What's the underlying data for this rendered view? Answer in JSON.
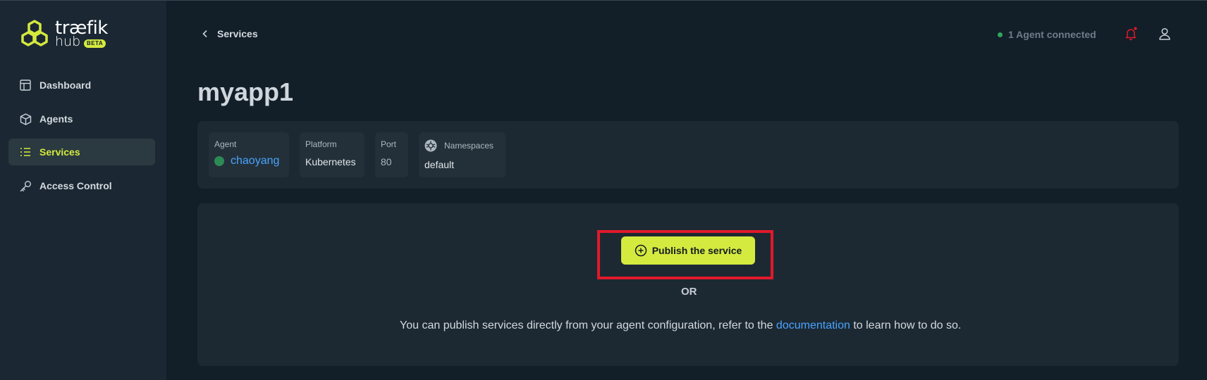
{
  "brand": {
    "name": "træfik",
    "sub": "hub",
    "badge": "BETA"
  },
  "sidebar": {
    "items": [
      {
        "label": "Dashboard",
        "icon": "dashboard-icon",
        "active": false
      },
      {
        "label": "Agents",
        "icon": "cube-icon",
        "active": false
      },
      {
        "label": "Services",
        "icon": "list-icon",
        "active": true
      },
      {
        "label": "Access Control",
        "icon": "key-icon",
        "active": false
      }
    ]
  },
  "header": {
    "back_label": "Services",
    "agent_status": "1 Agent connected",
    "notification_color": "#e0192a"
  },
  "page": {
    "title": "myapp1"
  },
  "info": {
    "agent": {
      "label": "Agent",
      "value": "chaoyang"
    },
    "platform": {
      "label": "Platform",
      "value": "Kubernetes"
    },
    "port": {
      "label": "Port",
      "value": "80"
    },
    "namespaces": {
      "label": "Namespaces",
      "value": "default"
    }
  },
  "publish": {
    "button_label": "Publish the service",
    "or_label": "OR",
    "help_before": "You can publish services directly from your agent configuration, refer to the ",
    "help_link": "documentation",
    "help_after": " to learn how to do so."
  },
  "colors": {
    "accent": "#d5ea3f",
    "link": "#4aa3ff",
    "highlight": "#e0192a",
    "status_connected": "#2fa55c"
  }
}
